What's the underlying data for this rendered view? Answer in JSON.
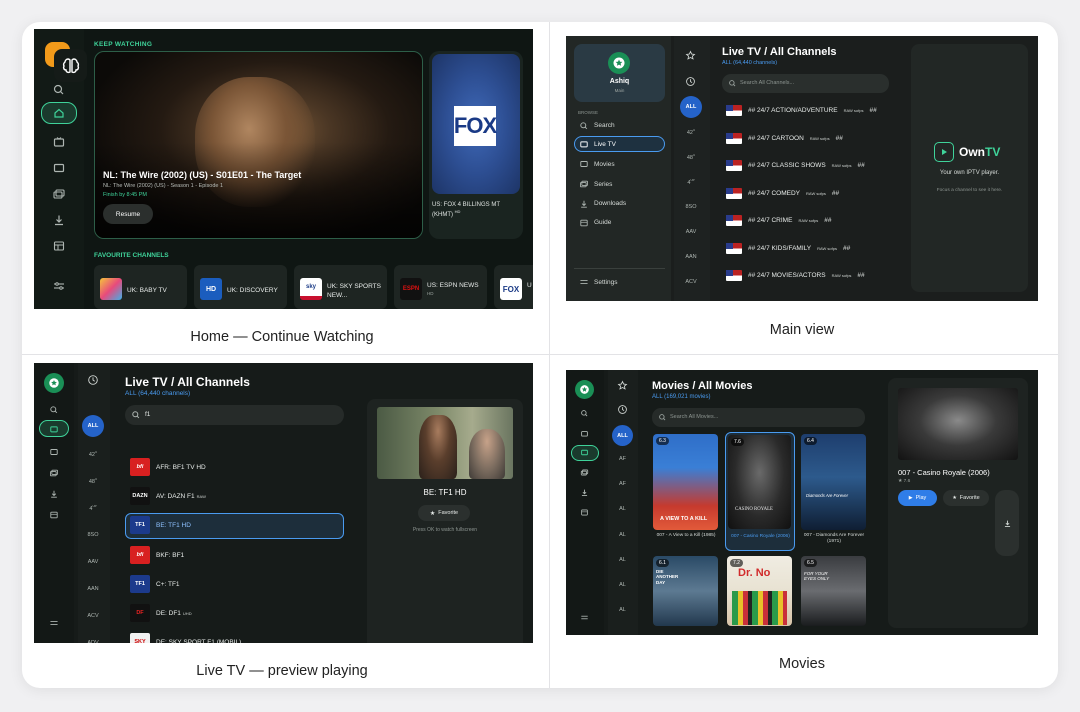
{
  "captions": {
    "home": "Home — Continue Watching",
    "main": "Main view",
    "livetv": "Live TV — preview playing",
    "movies": "Movies"
  },
  "home": {
    "keep_watching_label": "KEEP WATCHING",
    "hero_title": "NL: The Wire (2002) (US) - S01E01 - The Target",
    "hero_subtitle": "NL: The Wire (2002) (US) - Season 1 - Episode 1",
    "hero_time": "Finish by 8:45 PM",
    "resume_label": "Resume",
    "side_card_logo": "FOX",
    "side_card_title": "US: FOX 4 BILLINGS MT (KHMT)",
    "side_card_tag": "HD",
    "favourites_label": "FAVOURITE CHANNELS",
    "favourites": [
      {
        "logo": "baby",
        "name": "UK: BABY TV",
        "tag": ""
      },
      {
        "logo": "Discovery HD",
        "name": "UK: DISCOVERY",
        "tag": ""
      },
      {
        "logo": "sky",
        "name": "UK: SKY SPORTS NEW...",
        "tag": ""
      },
      {
        "logo": "ESPN",
        "name": "US: ESPN NEWS",
        "tag": "HD"
      },
      {
        "logo": "FOX",
        "name": "U",
        "tag": ""
      }
    ]
  },
  "main": {
    "profile_name": "Ashiq",
    "profile_sub": "Main",
    "browse_label": "BROWSE",
    "nav": [
      "Search",
      "Live TV",
      "Movies",
      "Series",
      "Downloads",
      "Guide"
    ],
    "settings_label": "Settings",
    "categories": [
      "ALL",
      "42",
      "48",
      "4",
      "8SO",
      "AAV",
      "AAN",
      "ACV"
    ],
    "category_sup": [
      "",
      "U",
      "U",
      "UP",
      "",
      "",
      "",
      ""
    ],
    "title": "Live TV / All Channels",
    "count": "ALL (64,440 channels)",
    "search_placeholder": "Search All Channels...",
    "channels": [
      {
        "name": "## 24/7 ACTION/ADVENTURE",
        "tag": "RAW sofps",
        "end": "##"
      },
      {
        "name": "## 24/7 CARTOON",
        "tag": "RAW sofps",
        "end": "##"
      },
      {
        "name": "## 24/7 CLASSIC SHOWS",
        "tag": "RAW sofps",
        "end": "##"
      },
      {
        "name": "## 24/7 COMEDY",
        "tag": "RAW sofps",
        "end": "##"
      },
      {
        "name": "## 24/7 CRIME",
        "tag": "RAW sofps",
        "end": "##"
      },
      {
        "name": "## 24/7 KIDS/FAMILY",
        "tag": "RAW sofps",
        "end": "##"
      },
      {
        "name": "## 24/7 MOVIES/ACTORS",
        "tag": "RAW sofps",
        "end": "##"
      }
    ],
    "brand_own": "Own",
    "brand_tv": "TV",
    "brand_tagline": "Your own IPTV player.",
    "brand_hint": "Focus a channel to see it here."
  },
  "livetv": {
    "categories": [
      "ALL",
      "42",
      "48",
      "4",
      "8SO",
      "AAV",
      "AAN",
      "ACV",
      "ADV"
    ],
    "category_sup": [
      "",
      "U",
      "U",
      "UP",
      "",
      "",
      "",
      "",
      ""
    ],
    "title": "Live TV / All Channels",
    "count": "ALL (64,440 channels)",
    "search_value": "f1",
    "channels": [
      {
        "logo": "bfi",
        "name": "AFR: BF1 TV HD",
        "tag": ""
      },
      {
        "logo": "DAZN",
        "name": "AV: DAZN F1",
        "tag": "RAW"
      },
      {
        "logo": "TF1",
        "name": "BE: TF1 HD",
        "tag": ""
      },
      {
        "logo": "bfi",
        "name": "BKF: BF1",
        "tag": ""
      },
      {
        "logo": "TF1",
        "name": "C+: TF1",
        "tag": ""
      },
      {
        "logo": "DF",
        "name": "DE: DF1",
        "tag": "UHD"
      },
      {
        "logo": "SKY",
        "name": "DE: SKY SPORT F1 (MOBIL)",
        "tag": ""
      }
    ],
    "preview_title": "BE: TF1 HD",
    "favorite_label": "Favorite",
    "preview_hint": "Press OK to watch fullscreen"
  },
  "movies": {
    "categories": [
      "ALL",
      "AF",
      "AF",
      "AL",
      "AL",
      "AL",
      "AL",
      "AL"
    ],
    "title": "Movies / All Movies",
    "count": "ALL (169,021 movies)",
    "search_placeholder": "Search All Movies...",
    "posters": [
      {
        "title": "007 - A View to a Kill (1985)",
        "rating": "6.3",
        "art": "A VIEW TO A KILL"
      },
      {
        "title": "007 - Casino Royale (2006)",
        "rating": "7.6",
        "art": "CASINO ROYALE"
      },
      {
        "title": "007 - Diamonds Are Forever (1971)",
        "rating": "6.4",
        "art": "Diamonds Are Forever"
      },
      {
        "title": "",
        "rating": "6.1",
        "art": "DIE ANOTHER DAY"
      },
      {
        "title": "",
        "rating": "7.2",
        "art": "Dr. No"
      },
      {
        "title": "",
        "rating": "6.5",
        "art": "FOR YOUR EYES ONLY"
      }
    ],
    "detail_title": "007 - Casino Royale (2006)",
    "detail_rating": "★ 7.6",
    "play_label": "Play",
    "favorite_label": "Favorite"
  }
}
